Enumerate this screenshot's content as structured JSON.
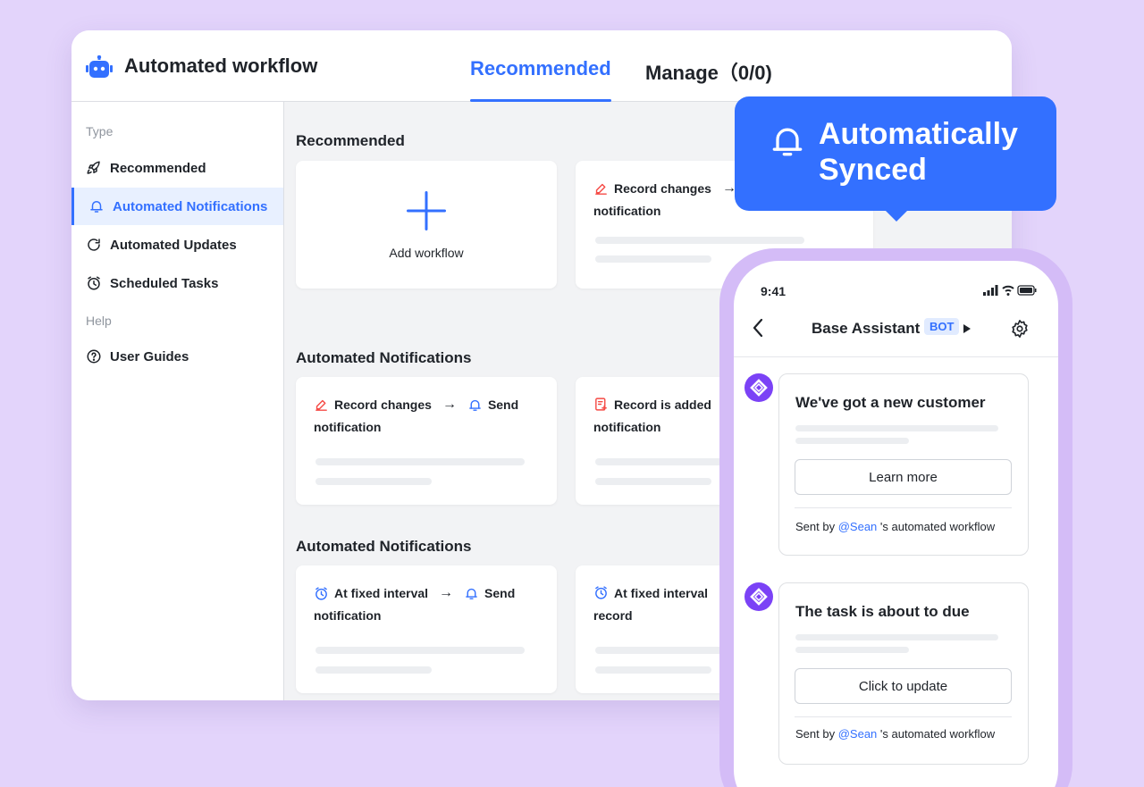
{
  "window": {
    "title": "Automated workflow",
    "tabs": [
      {
        "label": "Recommended",
        "active": true
      },
      {
        "label": "Manage（0/0)",
        "active": false
      }
    ]
  },
  "sidebar": {
    "section_type": "Type",
    "items": [
      {
        "label": "Recommended",
        "icon": "rocket-icon"
      },
      {
        "label": "Automated Notifications",
        "icon": "bell-icon",
        "active": true
      },
      {
        "label": "Automated Updates",
        "icon": "refresh-icon"
      },
      {
        "label": "Scheduled Tasks",
        "icon": "clock-icon"
      }
    ],
    "section_help": "Help",
    "help_items": [
      {
        "label": "User Guides",
        "icon": "question-circle-icon"
      }
    ]
  },
  "content": {
    "sections": [
      {
        "title": "Recommended",
        "cards": [
          {
            "type": "add",
            "label": "Add workflow"
          },
          {
            "trigger": "Record changes",
            "trigger_icon": "edit-icon",
            "action": "",
            "line2": "notification"
          }
        ]
      },
      {
        "title": "Automated Notifications",
        "cards": [
          {
            "trigger": "Record changes",
            "trigger_icon": "edit-icon",
            "action": "Send",
            "action_icon": "bell-icon",
            "line2": "notification"
          },
          {
            "trigger": "Record is added",
            "trigger_icon": "record-add-icon",
            "action": "",
            "line2": "notification"
          }
        ]
      },
      {
        "title": "Automated Notifications",
        "cards": [
          {
            "trigger": "At fixed interval",
            "trigger_icon": "alarm-icon",
            "action": "Send",
            "action_icon": "bell-icon",
            "line2": "notification"
          },
          {
            "trigger": "At fixed interval",
            "trigger_icon": "alarm-icon",
            "action": "",
            "line2": "record"
          }
        ]
      }
    ]
  },
  "callout": {
    "line1": "Automatically",
    "line2": "Synced",
    "icon": "bell-icon",
    "color": "#3370ff"
  },
  "phone": {
    "time": "9:41",
    "chat_title": "Base Assistant",
    "badge": "BOT",
    "messages": [
      {
        "title": "We've got a new customer",
        "button": "Learn more",
        "sent_by": "Sent by",
        "mention": "@Sean",
        "suffix": "'s automated workflow"
      },
      {
        "title": "The task is about to due",
        "button": "Click to update",
        "sent_by": "Sent by",
        "mention": "@Sean",
        "suffix": "'s automated workflow"
      }
    ]
  },
  "colors": {
    "background": "#e3d4fb",
    "accent": "#3370ff",
    "bot_avatar": "#7b42f6",
    "icon_red": "#f54a45",
    "phone_frame": "#d4bcf7"
  }
}
